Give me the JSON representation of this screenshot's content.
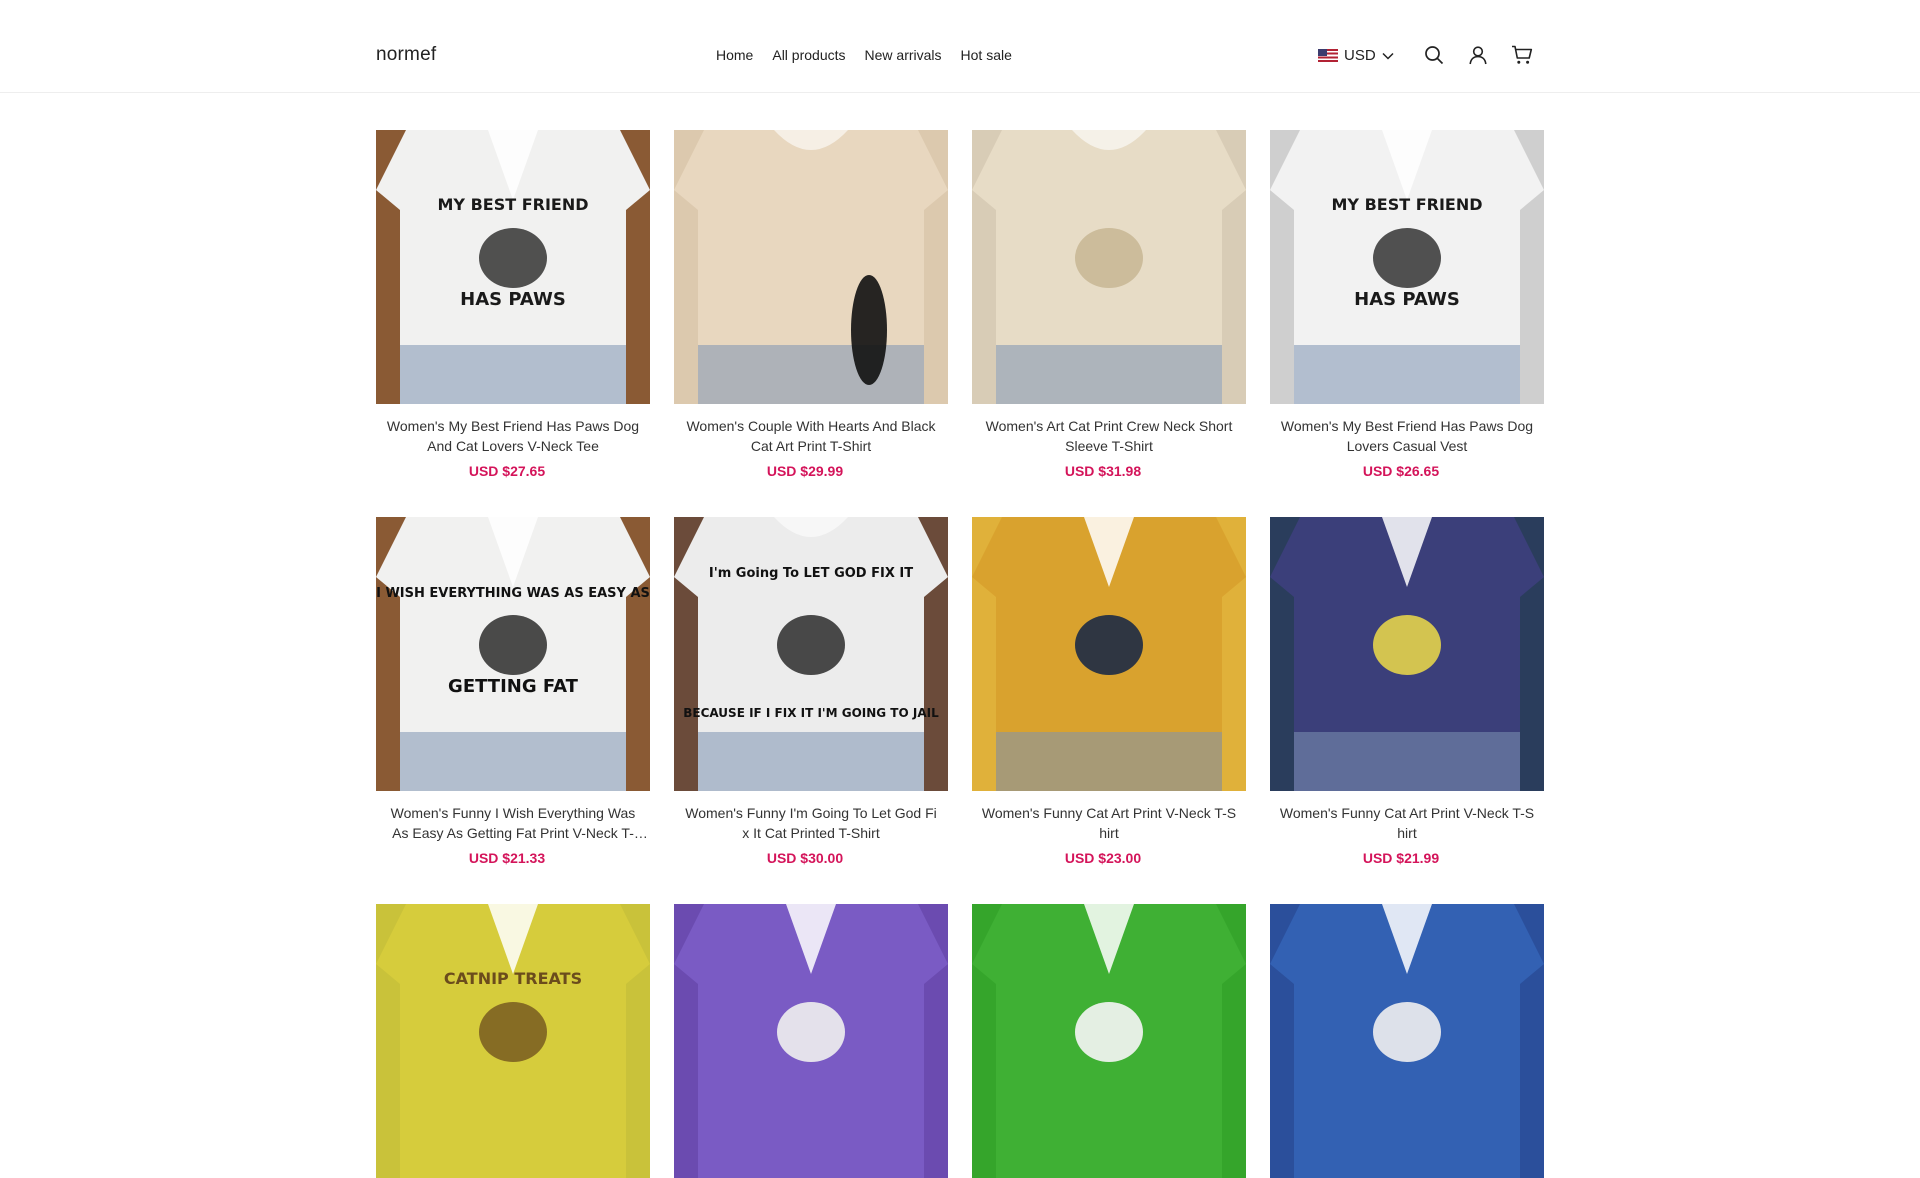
{
  "header": {
    "brand": "normef",
    "nav": [
      "Home",
      "All products",
      "New arrivals",
      "Hot sale"
    ],
    "currency": "USD",
    "icons": [
      "search-icon",
      "account-icon",
      "cart-icon"
    ]
  },
  "products": [
    {
      "title": "Women's My Best Friend Has Paws Dog And Cat Lovers V-Neck Tee",
      "price": "USD $27.65",
      "print_top": "MY BEST FRIEND",
      "print_bottom": "HAS PAWS",
      "bg": "#8a5a34",
      "shirt": "#f1f1f0",
      "ink": "#1a1a1a"
    },
    {
      "title": "Women's Couple With Hearts And Black Cat Art Print T-Shirt",
      "price": "USD $29.99",
      "print_top": "",
      "print_bottom": "",
      "bg": "#dcc9ae",
      "shirt": "#e8d7bf",
      "ink": "#111111"
    },
    {
      "title": "Women's Art Cat Print Crew Neck Short Sleeve T-Shirt",
      "price": "USD $31.98",
      "print_top": "",
      "print_bottom": "",
      "bg": "#d8ccb6",
      "shirt": "#e7dcc6",
      "ink": "#c9b896"
    },
    {
      "title": "Women's My Best Friend Has Paws Dog Lovers Casual Vest",
      "price": "USD $26.65",
      "print_top": "MY BEST FRIEND",
      "print_bottom": "HAS PAWS",
      "bg": "#cfcfcf",
      "shirt": "#f2f2f2",
      "ink": "#1a1a1a"
    },
    {
      "title": "Women's Funny I Wish Everything Was As Easy As Getting Fat Print V-Neck T-Shirt",
      "price": "USD $21.33",
      "print_top": "I WISH EVERYTHING WAS AS EASY AS",
      "print_bottom": "GETTING FAT",
      "bg": "#8a5a34",
      "shirt": "#f1f1f0",
      "ink": "#111111"
    },
    {
      "title": "Women's Funny I'm Going To Let God Fi x It Cat Printed T-Shirt",
      "price": "USD $30.00",
      "print_top": "I'm Going To LET GOD FIX IT",
      "print_bottom": "BECAUSE IF I FIX IT I'M GOING TO JAIL",
      "bg": "#6b4b3a",
      "shirt": "#ececec",
      "ink": "#111111"
    },
    {
      "title": "Women's Funny Cat Art Print V-Neck T-S hirt",
      "price": "USD $23.00",
      "print_top": "",
      "print_bottom": "",
      "bg": "#e0b13a",
      "shirt": "#d9a22e",
      "ink": "#1c2a45"
    },
    {
      "title": "Women's Funny Cat Art Print V-Neck T-S hirt",
      "price": "USD $21.99",
      "print_top": "",
      "print_bottom": "",
      "bg": "#2a3d5c",
      "shirt": "#3b3f7a",
      "ink": "#e4d34b"
    },
    {
      "title": "",
      "price": "",
      "print_top": "CATNIP TREATS",
      "print_bottom": "",
      "bg": "#c9c23a",
      "shirt": "#d6cc3c",
      "ink": "#6b4c1c"
    },
    {
      "title": "",
      "price": "",
      "print_top": "",
      "print_bottom": "",
      "bg": "#6b4bb0",
      "shirt": "#7a5bc4",
      "ink": "#f0f0f0"
    },
    {
      "title": "",
      "price": "",
      "print_top": "",
      "print_bottom": "",
      "bg": "#35a52b",
      "shirt": "#3fb034",
      "ink": "#f6f6f6"
    },
    {
      "title": "",
      "price": "",
      "print_top": "",
      "print_bottom": "",
      "bg": "#2b4f9b",
      "shirt": "#3361b3",
      "ink": "#f0f0f0"
    }
  ]
}
